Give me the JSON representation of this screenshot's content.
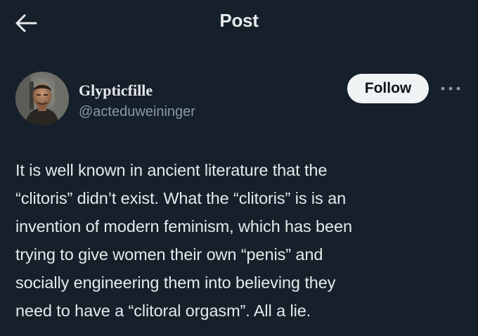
{
  "header": {
    "title": "Post",
    "back_icon": "arrow-left-icon"
  },
  "author": {
    "display_name": "Glypticfille",
    "handle": "@acteduweininger",
    "follow_label": "Follow",
    "more_icon": "more-horizontal-icon"
  },
  "post": {
    "text": "It is well known in ancient literature that the\n“clitoris” didn’t exist. What the “clitoris” is is an\ninvention of modern feminism, which has been\ntrying to give women their own “penis” and\nsocially engineering them into believing they\nneed to have a “clitoral orgasm”. All a lie."
  },
  "colors": {
    "background": "#15202b",
    "text_primary": "#e7e9ea",
    "text_secondary": "#8b98a5",
    "follow_button_bg": "#eff3f4"
  }
}
